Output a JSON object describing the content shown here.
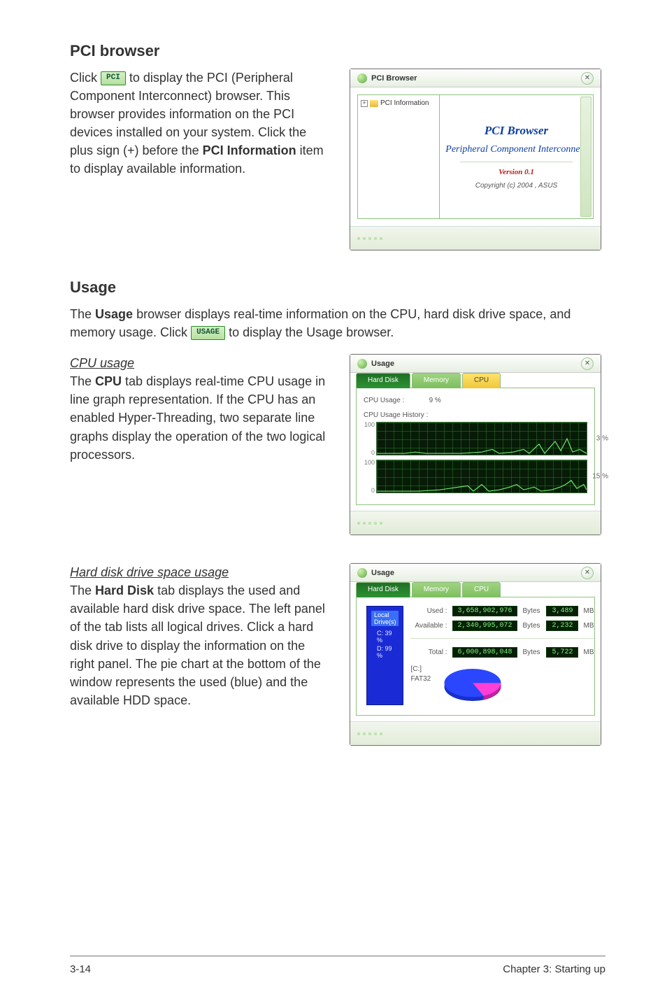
{
  "sections": {
    "pci": {
      "heading": "PCI browser",
      "para_prefix": "Click ",
      "btn_label": "PCI",
      "para_mid": " to display the PCI (Peripheral Component Interconnect) browser. This browser provides information on the PCI devices installed on your system. Click the plus sign (+) before the ",
      "emph": "PCI Information",
      "para_suffix": " item to display available information."
    },
    "usage": {
      "heading": "Usage",
      "intro_1": "The ",
      "intro_b": "Usage",
      "intro_2": " browser displays real-time information on the CPU, hard disk drive space, and memory usage. Click ",
      "btn_label": "USAGE",
      "intro_3": " to display the Usage browser.",
      "cpu_subhead": "CPU usage",
      "cpu_para_1": "The ",
      "cpu_b": "CPU",
      "cpu_para_2": " tab displays real-time CPU usage in line graph representation. If the CPU has an enabled Hyper-Threading, two separate line graphs display the operation of the two logical processors.",
      "hd_subhead": "Hard disk drive space usage",
      "hd_para_1": "The ",
      "hd_b": "Hard Disk",
      "hd_para_2": " tab displays the used and available hard disk drive space. The left panel of the tab lists all logical drives. Click a hard disk drive to display the information on the right panel. The pie chart at the bottom of the window represents the used (blue) and the available HDD space."
    }
  },
  "pci_window": {
    "title": "PCI Browser",
    "tree_node": "PCI Information",
    "main_title": "PCI  Browser",
    "main_sub": "Peripheral Component Interconnect",
    "version": "Version 0.1",
    "copyright": "Copyright (c) 2004 ,  ASUS"
  },
  "usage_cpu_window": {
    "title": "Usage",
    "tabs": {
      "hard_disk": "Hard Disk",
      "memory": "Memory",
      "cpu": "CPU"
    },
    "cpu_usage_label": "CPU Usage :",
    "cpu_usage_value": "9",
    "cpu_usage_unit": "%",
    "history_label": "CPU Usage History :",
    "scale_top": "100",
    "scale_bottom": "0",
    "pct1": "3 %",
    "pct2": "15 %"
  },
  "usage_hd_window": {
    "title": "Usage",
    "tabs": {
      "hard_disk": "Hard Disk",
      "memory": "Memory",
      "cpu": "CPU"
    },
    "left_caption": "Local Drive(s)",
    "drives": [
      "C:  39 %",
      "D:  99 %"
    ],
    "used_label": "Used :",
    "used_bytes": "3,658,902,976",
    "used_mb": "3,489",
    "avail_label": "Available :",
    "avail_bytes": "2,340,995,072",
    "avail_mb": "2,232",
    "total_label": "Total :",
    "total_bytes": "6,000,898,048",
    "total_mb": "5,722",
    "unit_bytes": "Bytes",
    "unit_mb": "MB",
    "drive_name": "[C:]",
    "fs": "FAT32"
  },
  "footer": {
    "left": "3-14",
    "right": "Chapter 3: Starting up"
  }
}
